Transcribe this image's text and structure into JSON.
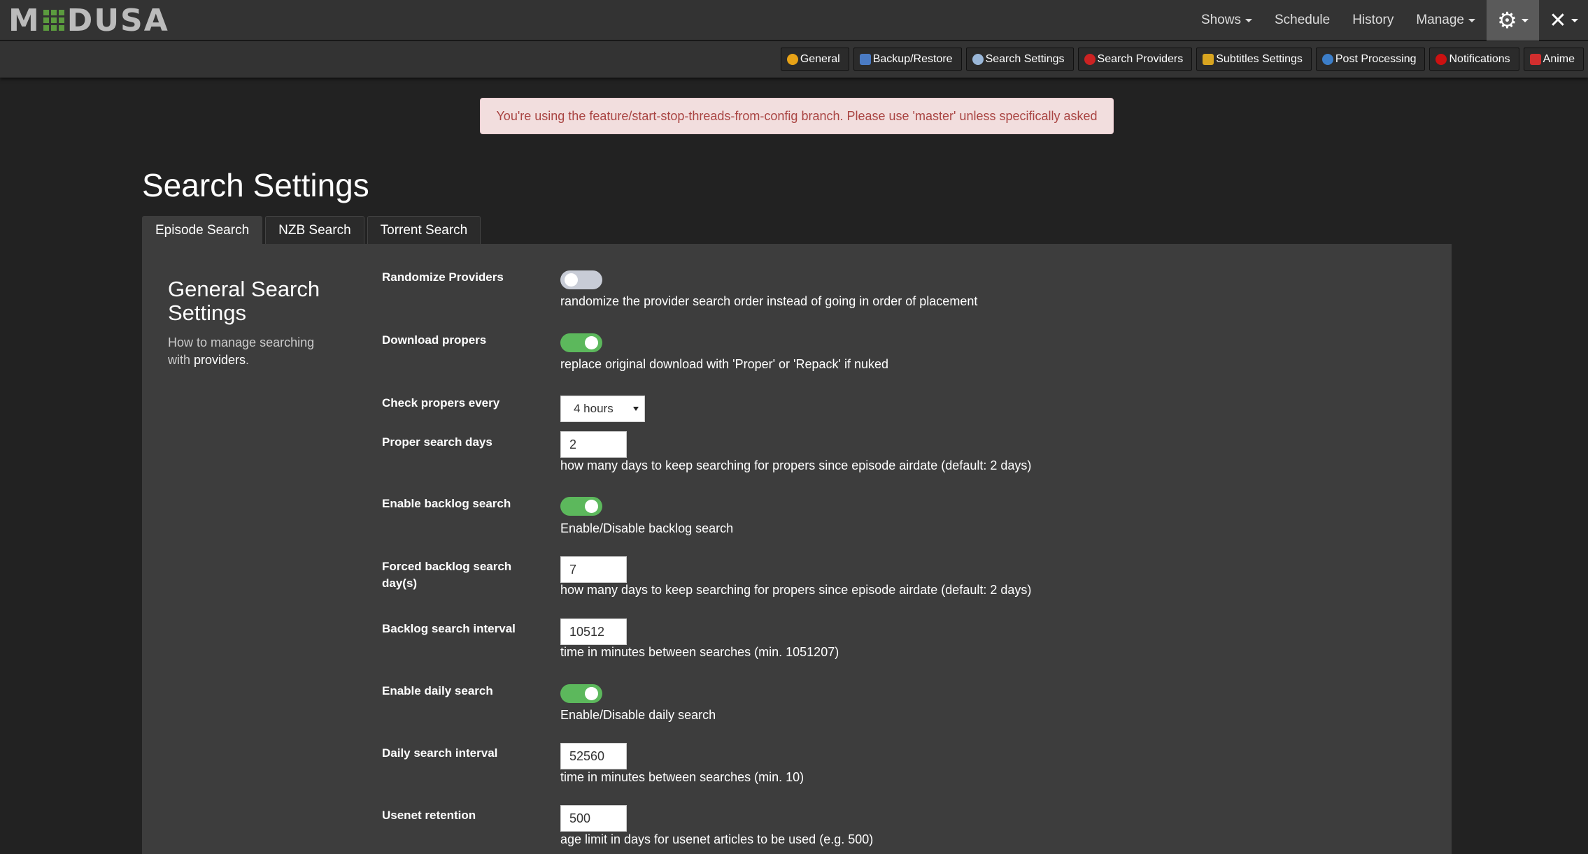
{
  "app": {
    "logo_left": "M",
    "logo_right": "DUSA"
  },
  "nav": {
    "shows": "Shows",
    "schedule": "Schedule",
    "history": "History",
    "manage": "Manage"
  },
  "subnav": [
    {
      "label": "General",
      "icon": "gear-icon",
      "color": "#e8a317"
    },
    {
      "label": "Backup/Restore",
      "icon": "floppy-icon",
      "color": "#4a7bc4"
    },
    {
      "label": "Search Settings",
      "icon": "magnifier-icon",
      "color": "#9ab7d8"
    },
    {
      "label": "Search Providers",
      "icon": "provider-icon",
      "color": "#cc2222"
    },
    {
      "label": "Subtitles Settings",
      "icon": "subtitles-icon",
      "color": "#d9a520"
    },
    {
      "label": "Post Processing",
      "icon": "refresh-icon",
      "color": "#3c7ec9"
    },
    {
      "label": "Notifications",
      "icon": "bell-icon",
      "color": "#cc1111"
    },
    {
      "label": "Anime",
      "icon": "anime-icon",
      "color": "#d22e2e"
    }
  ],
  "alert": "You're using the feature/start-stop-threads-from-config branch. Please use 'master' unless specifically asked",
  "page_title": "Search Settings",
  "tabs": [
    "Episode Search",
    "NZB Search",
    "Torrent Search"
  ],
  "section": {
    "title": "General Search Settings",
    "desc_prefix": "How to manage searching with ",
    "desc_link": "providers",
    "desc_suffix": "."
  },
  "rows": {
    "randomize": {
      "label": "Randomize Providers",
      "desc": "randomize the provider search order instead of going in order of placement",
      "on": false
    },
    "propers": {
      "label": "Download propers",
      "desc": "replace original download with 'Proper' or 'Repack' if nuked",
      "on": true
    },
    "check_propers": {
      "label": "Check propers every",
      "value": "4 hours"
    },
    "proper_days": {
      "label": "Proper search days",
      "value": "2",
      "desc": "how many days to keep searching for propers since episode airdate (default: 2 days)"
    },
    "backlog": {
      "label": "Enable backlog search",
      "desc": "Enable/Disable backlog search",
      "on": true
    },
    "forced_backlog": {
      "label": "Forced backlog search day(s)",
      "value": "7",
      "desc": "how many days to keep searching for propers since episode airdate (default: 2 days)"
    },
    "backlog_interval": {
      "label": "Backlog search interval",
      "value": "10512",
      "desc": "time in minutes between searches (min. 1051207)"
    },
    "daily": {
      "label": "Enable daily search",
      "desc": "Enable/Disable daily search",
      "on": true
    },
    "daily_interval": {
      "label": "Daily search interval",
      "value": "52560",
      "desc": "time in minutes between searches (min. 10)"
    },
    "usenet": {
      "label": "Usenet retention",
      "value": "500",
      "desc": "age limit in days for usenet articles to be used (e.g. 500)"
    }
  }
}
